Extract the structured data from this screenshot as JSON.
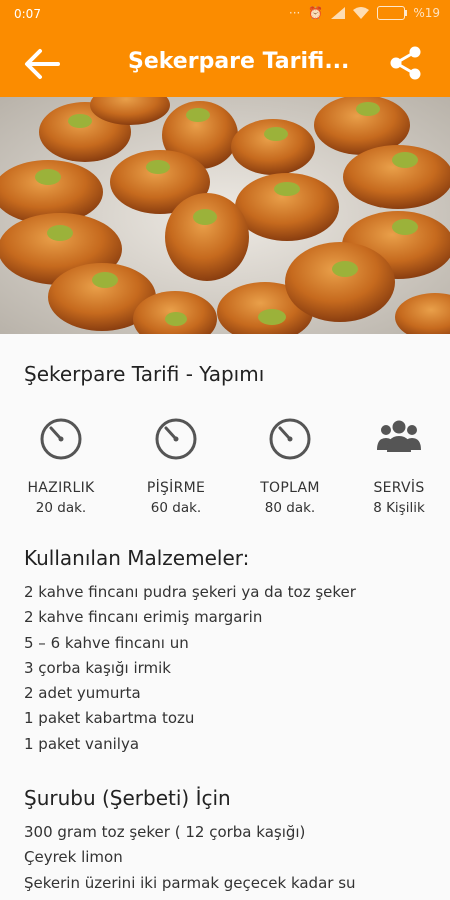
{
  "status_bar": {
    "time": "0:07",
    "battery": "%19",
    "icons": [
      "dots-icon",
      "alarm-icon",
      "signal-icon",
      "wifi-icon",
      "battery-icon"
    ]
  },
  "app_bar": {
    "title": "Şekerpare Tarifi...",
    "back_icon": "arrow-left-icon",
    "share_icon": "share-icon"
  },
  "hero": {
    "description": "photo of şekerpare cookies on a tray"
  },
  "recipe": {
    "title": "Şekerpare Tarifi - Yapımı",
    "stats": [
      {
        "label": "HAZIRLIK",
        "value": "20 dak.",
        "icon": "timer-icon"
      },
      {
        "label": "PİŞİRME",
        "value": "60 dak.",
        "icon": "timer-icon"
      },
      {
        "label": "TOPLAM",
        "value": "80 dak.",
        "icon": "timer-icon"
      },
      {
        "label": "SERVİS",
        "value": "8 Kişilik",
        "icon": "people-icon"
      }
    ],
    "ingredients_title": "Kullanılan Malzemeler:",
    "ingredients": [
      "2 kahve fincanı pudra şekeri ya da toz şeker",
      "2 kahve fincanı erimiş margarin",
      "5 – 6 kahve fincanı un",
      "3 çorba kaşığı irmik",
      "2 adet yumurta",
      "1 paket kabartma tozu",
      "1 paket vanilya"
    ],
    "syrup_title": "Şurubu (Şerbeti) İçin",
    "syrup": [
      "300 gram toz şeker ( 12 çorba kaşığı)",
      "Çeyrek limon",
      "Şekerin üzerini iki parmak geçecek kadar su"
    ]
  },
  "colors": {
    "accent": "#fb8c00",
    "icon_gray": "#555555",
    "text": "#222222"
  }
}
